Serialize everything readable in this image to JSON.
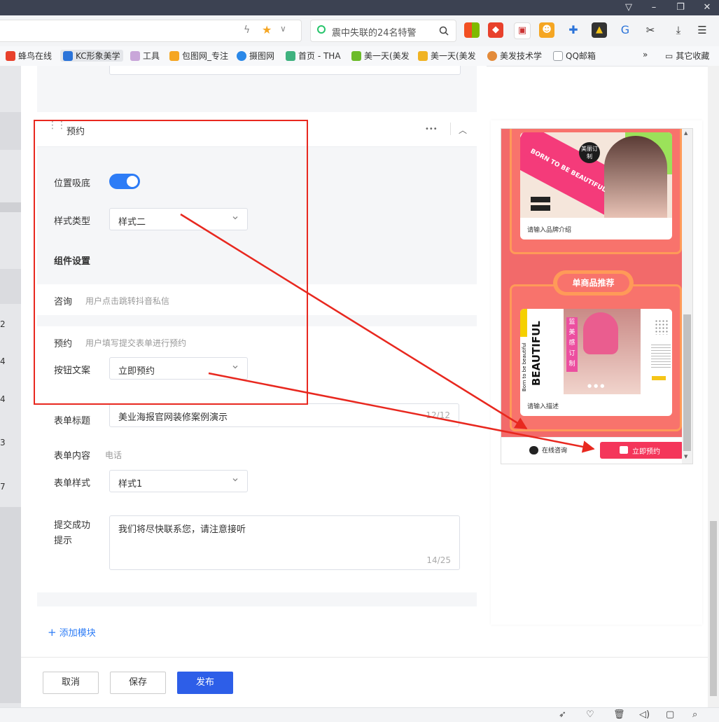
{
  "browser": {
    "search_text": "震中失联的24名特警",
    "window_controls": [
      "▽",
      "–",
      "❐",
      "✕"
    ],
    "bookmarks": [
      {
        "label": "蜂鸟在线",
        "icon": "red-logo-icon",
        "color": "#e8412c"
      },
      {
        "label": "KC形象美学",
        "icon": "kc-logo-icon",
        "color": "#2a73d9"
      },
      {
        "label": "工具",
        "icon": "tool-icon",
        "color": "#c9a6d9"
      },
      {
        "label": "包图网_专注",
        "icon": "baotu-icon",
        "color": "#f5a623"
      },
      {
        "label": "摄图网",
        "icon": "shetu-icon",
        "color": "#2a88e8"
      },
      {
        "label": "首页 - THA",
        "icon": "vue-icon",
        "color": "#3fb27f"
      },
      {
        "label": "美一天(美发",
        "icon": "hi-icon",
        "color": "#6cbb2a"
      },
      {
        "label": "美一天(美发",
        "icon": "m-logo-icon",
        "color": "#f0b323"
      },
      {
        "label": "美发技术学",
        "icon": "globe-icon",
        "color": "#e38b3a"
      },
      {
        "label": "QQ邮箱",
        "icon": "doc-icon",
        "color": "#9aa0a6"
      }
    ],
    "overflow": "»",
    "other_bookmarks": "其它收藏"
  },
  "left_strip_numbers": [
    "2",
    "4",
    "4",
    "3",
    "7"
  ],
  "section": {
    "title": "预约",
    "more": "•••",
    "collapse": "︿"
  },
  "form": {
    "position_label": "位置吸底",
    "position_on": true,
    "style_type_label": "样式类型",
    "style_type_value": "样式二",
    "component_settings": "组件设置",
    "consult_label": "咨询",
    "consult_desc": "用户点击跳转抖音私信",
    "booking_label": "预约",
    "booking_desc": "用户填写提交表单进行预约",
    "button_text_label": "按钮文案",
    "button_text_value": "立即预约",
    "form_title_label": "表单标题",
    "form_title_value": "美业海报官网装修案例演示",
    "form_title_count": "12/12",
    "form_content_label": "表单内容",
    "form_content_value": "电话",
    "form_style_label": "表单样式",
    "form_style_value": "样式1",
    "success_label_line1": "提交成功",
    "success_label_line2": "提示",
    "success_value": "我们将尽快联系您，请注意接听",
    "success_count": "14/25",
    "add_module": "添加模块"
  },
  "footer": {
    "cancel": "取消",
    "save": "保存",
    "publish": "发布"
  },
  "preview": {
    "brand_placeholder": "请输入品牌介绍",
    "section_title": "单商品推荐",
    "desc_placeholder": "请输入描述",
    "consult_btn": "在线咨询",
    "book_btn": "立即预约",
    "poster1_text": "BORN TO BE BEAUTIFUL",
    "poster1_badge": "美丽订制",
    "poster2_text": "BEAUTIFUL",
    "poster2_sub": "Born to be beautiful",
    "poster2_vertical": "监美感订制",
    "accent": "#f4365a"
  },
  "colors": {
    "annotation_red": "#e8281f",
    "primary_blue": "#2d5ee8",
    "toggle_blue": "#2d7cf6"
  }
}
